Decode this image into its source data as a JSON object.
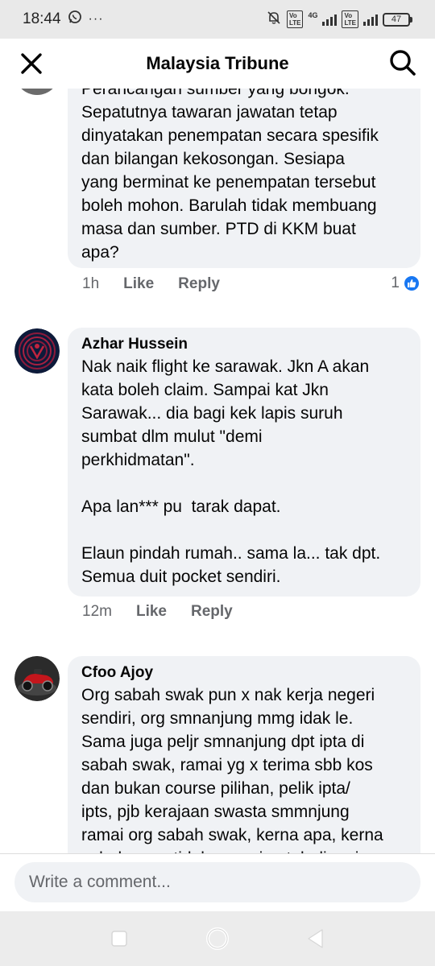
{
  "status_bar": {
    "time": "18:44",
    "whatsapp_icon": "whatsapp-icon",
    "more_label": "···",
    "net_label": "4G",
    "vo_label": "Vo",
    "lte_label": "LTE",
    "battery": "47"
  },
  "header": {
    "title": "Malaysia Tribune",
    "close_icon": "close-icon",
    "search_icon": "search-icon"
  },
  "comments": [
    {
      "text_cut_top": "Perancangan sumber yang bongok.",
      "text": "Sepatutnya tawaran jawatan tetap\ndinyatakan penempatan secara spesifik\ndan bilangan kekosongan. Sesiapa\nyang berminat ke penempatan tersebut\nboleh mohon. Barulah tidak membuang\nmasa dan sumber. PTD di KKM buat\napa?",
      "time": "1h",
      "like_label": "Like",
      "reply_label": "Reply",
      "reaction_count": "1",
      "reaction_icon": "like-reaction-icon"
    },
    {
      "author": "Azhar Hussein",
      "text": "Nak naik flight ke sarawak. Jkn A akan\nkata boleh claim. Sampai kat Jkn\nSarawak... dia bagi kek lapis suruh\nsumbat dlm mulut \"demi\nperkhidmatan\".\n\nApa lan*** pu  tarak dapat.\n\nElaun pindah rumah.. sama la... tak dpt.\nSemua duit pocket sendiri.",
      "time": "12m",
      "like_label": "Like",
      "reply_label": "Reply"
    },
    {
      "author": "Cfoo Ajoy",
      "text": "Org sabah swak pun x nak kerja negeri\nsendiri, org smnanjung mmg idak le.\nSama juga peljr smnanjung dpt ipta di\nsabah swak, ramai yg x terima sbb kos\ndan bukan course pilihan, pelik ipta/\nipts, pjb kerajaan swasta smmnjung\nramai org sabah swak, kerna apa, kerna\nsebab sana tidak sesuai untuk di cari"
    }
  ],
  "composer": {
    "placeholder": "Write a comment..."
  },
  "nav": {
    "recents_icon": "recents-square-icon",
    "home_icon": "home-circle-icon",
    "back_icon": "back-triangle-icon"
  },
  "colors": {
    "accent": "#1877f2",
    "bubble": "#f0f2f5",
    "secondary_text": "#65676b"
  }
}
